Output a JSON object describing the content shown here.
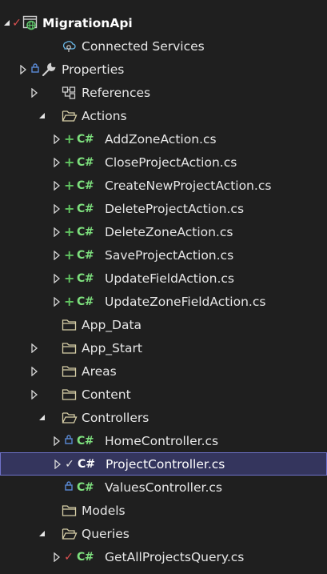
{
  "solution_explorer": {
    "project_name": "MigrationApi",
    "items": {
      "connected_services": "Connected Services",
      "properties": "Properties",
      "references": "References",
      "actions_folder": "Actions",
      "actions": [
        "AddZoneAction.cs",
        "CloseProjectAction.cs",
        "CreateNewProjectAction.cs",
        "DeleteProjectAction.cs",
        "DeleteZoneAction.cs",
        "SaveProjectAction.cs",
        "UpdateFieldAction.cs",
        "UpdateZoneFieldAction.cs"
      ],
      "app_data": "App_Data",
      "app_start": "App_Start",
      "areas": "Areas",
      "content": "Content",
      "controllers_folder": "Controllers",
      "controllers": [
        "HomeController.cs",
        "ProjectController.cs",
        "ValuesController.cs"
      ],
      "models": "Models",
      "queries_folder": "Queries",
      "queries": [
        "GetAllProjectsQuery.cs"
      ]
    },
    "file_type_glyph": "C#",
    "selected_item": "ProjectController.cs"
  },
  "colors": {
    "background": "#1f1f1f",
    "selection_bg": "#34355d",
    "selection_border": "#6f72c9",
    "csharp_green": "#7ee07e",
    "added_green": "#61c561",
    "checked_red": "#e05252",
    "lock_blue": "#5b8ad6",
    "folder": "#dcdcdc"
  }
}
